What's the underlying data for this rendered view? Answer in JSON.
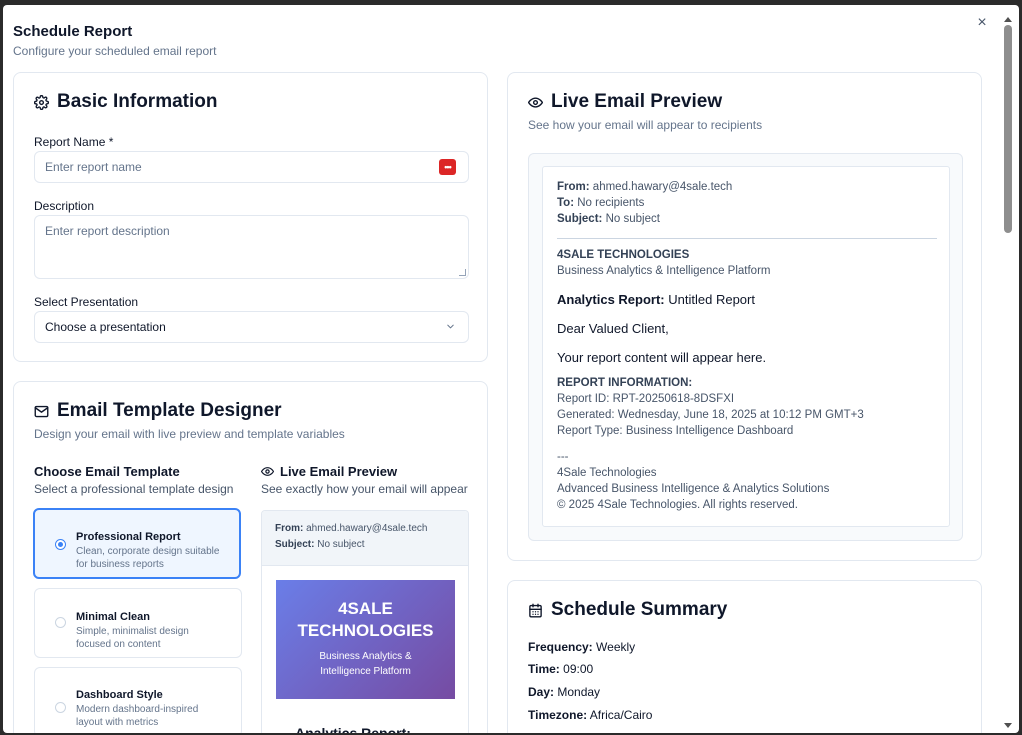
{
  "modal": {
    "title": "Schedule Report",
    "subtitle": "Configure your scheduled email report",
    "close_icon": "×"
  },
  "basic": {
    "title": "Basic Information",
    "icon": "gear-icon",
    "report_name_label": "Report Name *",
    "report_name_placeholder": "Enter report name",
    "password_badge": "•••",
    "description_label": "Description",
    "description_placeholder": "Enter report description",
    "presentation_label": "Select Presentation",
    "presentation_value": "Choose a presentation"
  },
  "live_preview": {
    "title": "Live Email Preview",
    "subtitle": "See how your email will appear to recipients",
    "from_label": "From:",
    "from_value": "ahmed.hawary@4sale.tech",
    "to_label": "To:",
    "to_value": "No recipients",
    "subject_label": "Subject:",
    "subject_value": "No subject",
    "company": "4SALE TECHNOLOGIES",
    "platform": "Business Analytics & Intelligence Platform",
    "report_label": "Analytics Report:",
    "report_value": "Untitled Report",
    "greeting": "Dear Valued Client,",
    "content": "Your report content will appear here.",
    "info_heading": "REPORT INFORMATION:",
    "report_id": "Report ID: RPT-20250618-8DSFXI",
    "generated": "Generated: Wednesday, June 18, 2025 at 10:12 PM GMT+3",
    "report_type": "Report Type: Business Intelligence Dashboard",
    "sep": "---",
    "footer_company": "4Sale Technologies",
    "footer_tagline": "Advanced Business Intelligence & Analytics Solutions",
    "footer_copyright": "© 2025 4Sale Technologies. All rights reserved."
  },
  "designer": {
    "title": "Email Template Designer",
    "subtitle": "Design your email with live preview and template variables",
    "choose_title": "Choose Email Template",
    "choose_sub": "Select a professional template design",
    "preview_title": "Live Email Preview",
    "preview_sub": "See exactly how your email will appear",
    "templates": [
      {
        "name": "Professional Report",
        "desc": "Clean, corporate design suitable for business reports",
        "selected": true
      },
      {
        "name": "Minimal Clean",
        "desc": "Simple, minimalist design focused on content",
        "selected": false
      },
      {
        "name": "Dashboard Style",
        "desc": "Modern dashboard-inspired layout with metrics",
        "selected": false
      }
    ],
    "mini": {
      "from_label": "From:",
      "from_value": "ahmed.hawary@4sale.tech",
      "subject_label": "Subject:",
      "subject_value": "No subject",
      "banner_line1": "4SALE",
      "banner_line2": "TECHNOLOGIES",
      "banner_sub1": "Business Analytics &",
      "banner_sub2": "Intelligence Platform",
      "report_title": "Analytics Report:"
    }
  },
  "summary": {
    "title": "Schedule Summary",
    "frequency_label": "Frequency:",
    "frequency_value": "Weekly",
    "time_label": "Time:",
    "time_value": "09:00",
    "day_label": "Day:",
    "day_value": "Monday",
    "timezone_label": "Timezone:",
    "timezone_value": "Africa/Cairo"
  },
  "colors": {
    "accent": "#3b82f6",
    "badge": "#dc2626",
    "banner_start": "#6a7ee8",
    "banner_end": "#764ba2"
  }
}
